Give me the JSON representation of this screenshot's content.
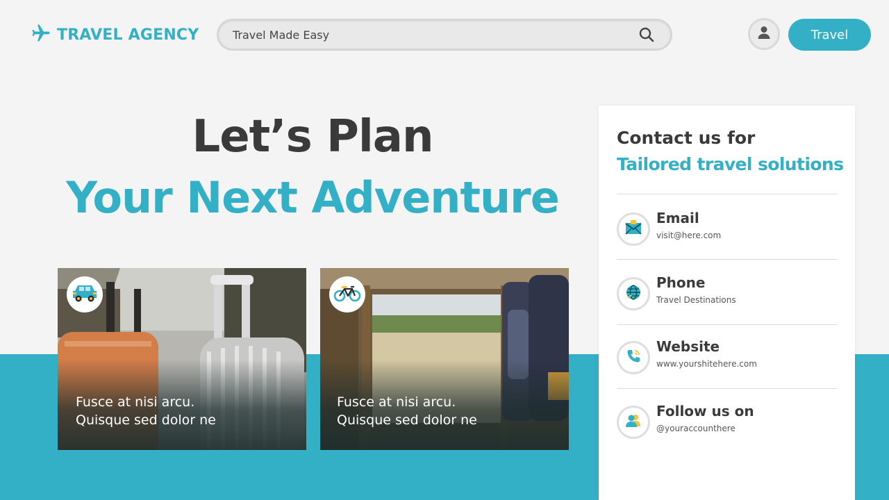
{
  "brand": {
    "name": "TRAVEL AGENCY",
    "icon": "airplane-icon",
    "color": "#33b0c5"
  },
  "search": {
    "placeholder": "Travel Made Easy",
    "icon": "search-icon"
  },
  "header": {
    "avatar_icon": "user-icon",
    "button_label": "Travel"
  },
  "hero": {
    "line1": "Let’s Plan",
    "line2": "Your Next Adventure"
  },
  "cards": [
    {
      "icon": "car-icon",
      "line1": "Fusce at nisi arcu.",
      "line2": "Quisque sed dolor ne"
    },
    {
      "icon": "bicycle-icon",
      "line1": "Fusce at nisi arcu.",
      "line2": "Quisque sed dolor ne"
    }
  ],
  "contact": {
    "title": "Contact us for",
    "subtitle": "Tailored travel solutions",
    "items": [
      {
        "icon": "envelope-icon",
        "label": "Email",
        "value": "visit@here.com"
      },
      {
        "icon": "globe-icon",
        "label": "Phone",
        "value": "Travel Destinations"
      },
      {
        "icon": "phone-icon",
        "label": "Website",
        "value": "www.yourshitehere.com"
      },
      {
        "icon": "people-icon",
        "label": "Follow us on",
        "value": "@youraccounthere"
      }
    ]
  },
  "colors": {
    "accent": "#33b0c5",
    "background": "#f4f4f5",
    "text": "#3a3a3a"
  }
}
